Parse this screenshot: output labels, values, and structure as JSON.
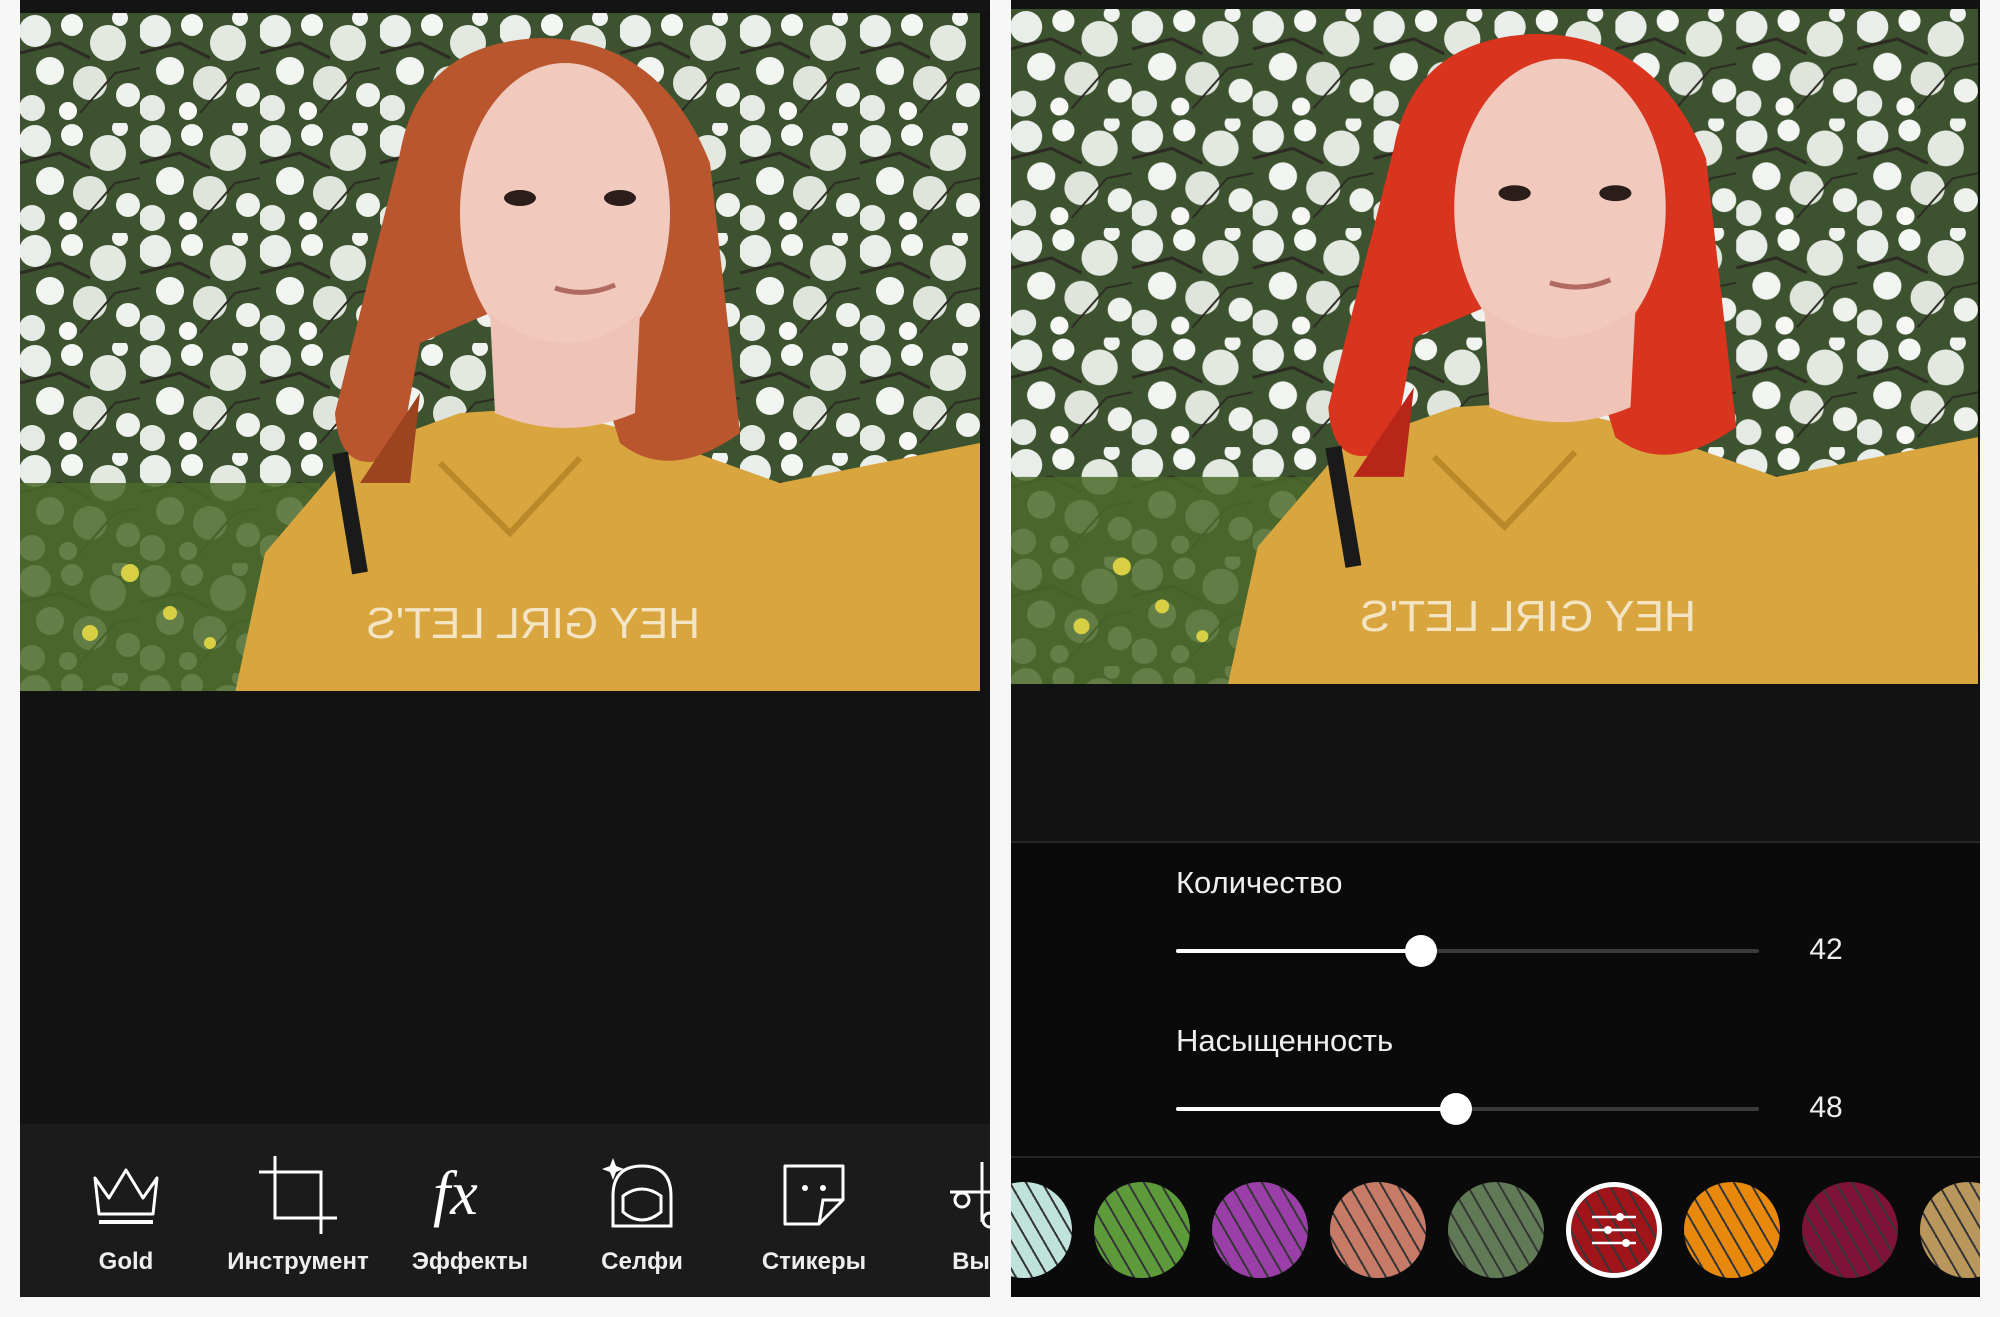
{
  "left_panel": {
    "toolbar": {
      "items": [
        {
          "label": "Gold",
          "icon": "crown-icon"
        },
        {
          "label": "Инструмент",
          "icon": "crop-icon"
        },
        {
          "label": "Эффекты",
          "icon": "fx-icon"
        },
        {
          "label": "Селфи",
          "icon": "selfie-face-icon"
        },
        {
          "label": "Стикеры",
          "icon": "sticker-icon"
        },
        {
          "label": "Выре",
          "icon": "cutout-scissors-icon"
        }
      ]
    }
  },
  "right_panel": {
    "sliders": [
      {
        "label": "Количество",
        "value": 42,
        "max": 100
      },
      {
        "label": "Насыщенность",
        "value": 48,
        "max": 100
      }
    ],
    "hair_colors": [
      {
        "color": "#bfe3da",
        "selected": false
      },
      {
        "color": "#5c9a3a",
        "selected": false
      },
      {
        "color": "#9a3fa8",
        "selected": false
      },
      {
        "color": "#c77a66",
        "selected": false
      },
      {
        "color": "#5f7a55",
        "selected": false
      },
      {
        "color": "#a0141a",
        "selected": true,
        "icon": "adjust-sliders-icon"
      },
      {
        "color": "#e8890e",
        "selected": false
      },
      {
        "color": "#7e1238",
        "selected": false
      },
      {
        "color": "#b9975c",
        "selected": false
      }
    ]
  },
  "colors": {
    "background": "#121212",
    "toolbar": "#1b1b1b",
    "hair_original": "#b9562d",
    "hair_edited": "#d8341e",
    "hoodie": "#d9a53e"
  }
}
